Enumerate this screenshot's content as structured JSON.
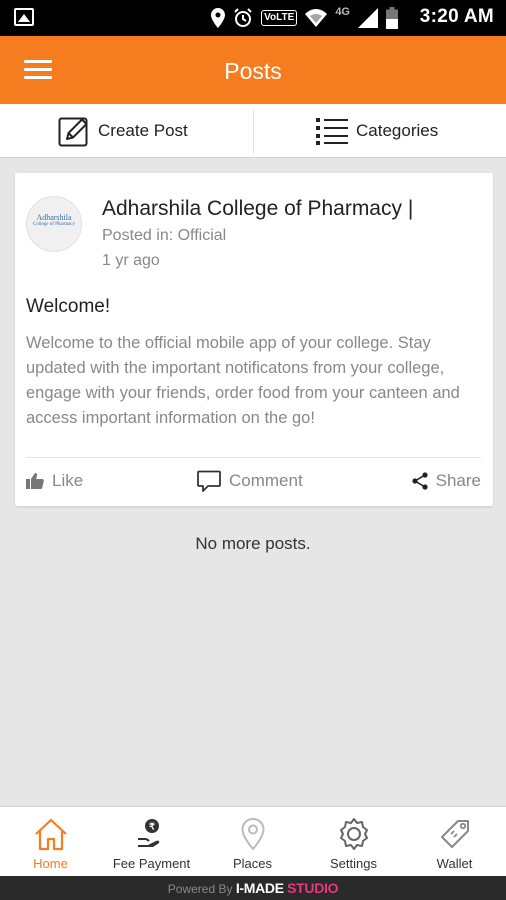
{
  "status_bar": {
    "time": "3:20 AM",
    "volte": "VoLTE",
    "network": "4G",
    "icons": [
      "image-icon",
      "location-icon",
      "alarm-icon",
      "volte-icon",
      "wifi-icon",
      "signal-icon",
      "battery-icon"
    ]
  },
  "app_bar": {
    "title": "Posts",
    "menu_icon": "menu-icon"
  },
  "actions": {
    "create_post": "Create Post",
    "categories": "Categories"
  },
  "post": {
    "author": "Adharshila College of Pharmacy |",
    "avatar_text": "Adharshila",
    "avatar_subtext": "College of Pharmacy",
    "category": "Posted in: Official",
    "time": "1 yr ago",
    "title": "Welcome!",
    "body": "Welcome to the official mobile app of your college. Stay updated with the important notificatons from your college, engage with your friends, order food from your canteen and access important information on the go!",
    "like_label": "Like",
    "comment_label": "Comment",
    "share_label": "Share"
  },
  "feed": {
    "end_message": "No more posts."
  },
  "bottom_nav": {
    "items": [
      {
        "label": "Home",
        "icon": "home-icon",
        "active": true
      },
      {
        "label": "Fee Payment",
        "icon": "fee-payment-icon",
        "active": false
      },
      {
        "label": "Places",
        "icon": "places-icon",
        "active": false
      },
      {
        "label": "Settings",
        "icon": "settings-icon",
        "active": false
      },
      {
        "label": "Wallet",
        "icon": "wallet-icon",
        "active": false
      }
    ]
  },
  "footer": {
    "powered_by": "Powered By",
    "brand": "I-MADE",
    "brand_suffix": "STUDIO"
  },
  "colors": {
    "accent": "#f57c1f",
    "background": "#e6e6e6",
    "brand_pink": "#e8367f"
  }
}
